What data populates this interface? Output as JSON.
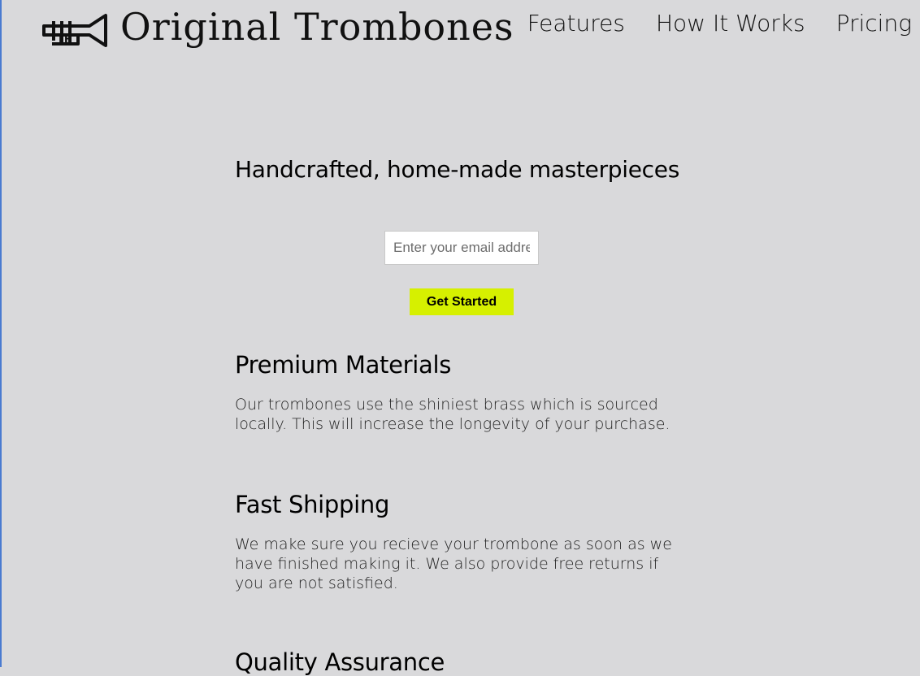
{
  "header": {
    "brand": "Original Trombones",
    "logo_icon": "trombone-logo-icon",
    "nav": [
      {
        "label": "Features"
      },
      {
        "label": "How It Works"
      },
      {
        "label": "Pricing"
      }
    ]
  },
  "hero": {
    "title": "Handcrafted, home-made masterpieces",
    "email_placeholder": "Enter your email address",
    "cta_label": "Get Started"
  },
  "features": [
    {
      "title": "Premium Materials",
      "text": "Our trombones use the shiniest brass which is sourced locally. This will increase the longevity of your purchase."
    },
    {
      "title": "Fast Shipping",
      "text": "We make sure you recieve your trombone as soon as we have finished making it. We also provide free returns if you are not satisfied."
    },
    {
      "title": "Quality Assurance"
    }
  ],
  "colors": {
    "background": "#d9d9db",
    "cta": "#d6f000"
  }
}
